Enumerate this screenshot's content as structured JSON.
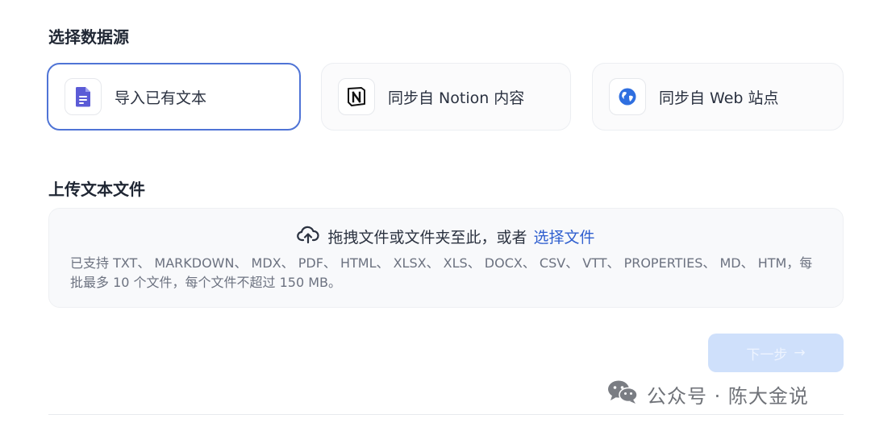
{
  "source_section": {
    "title": "选择数据源",
    "options": [
      {
        "label": "导入已有文本",
        "icon": "document-icon",
        "selected": true
      },
      {
        "label": "同步自 Notion 内容",
        "icon": "notion-icon",
        "selected": false
      },
      {
        "label": "同步自 Web 站点",
        "icon": "globe-icon",
        "selected": false
      }
    ]
  },
  "upload_section": {
    "title": "上传文本文件",
    "drop_text": "拖拽文件或文件夹至此，或者",
    "select_link": "选择文件",
    "support_text": "已支持 TXT、 MARKDOWN、 MDX、 PDF、 HTML、 XLSX、 XLS、 DOCX、 CSV、 VTT、 PROPERTIES、 MD、 HTM，每批最多 10 个文件，每个文件不超过 150 MB。"
  },
  "next_button": {
    "label": "下一步",
    "arrow": "→",
    "disabled": true
  },
  "watermark": {
    "text": "公众号 · 陈大金说"
  },
  "colors": {
    "accent": "#4f74d6",
    "link": "#2f5fcf",
    "button_disabled": "#cfe0fb",
    "document_icon": "#5b5bd6",
    "globe_icon": "#2f6fe0"
  }
}
